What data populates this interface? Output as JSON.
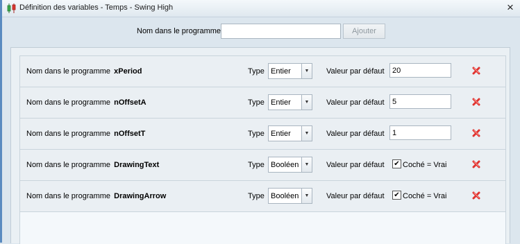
{
  "window": {
    "title": "Définition des variables - Temps - Swing High",
    "close_glyph": "×"
  },
  "top": {
    "label": "Nom dans le programme",
    "input_value": "",
    "add_button": "Ajouter"
  },
  "rows": [
    {
      "name_label": "Nom dans le programme",
      "name": "xPeriod",
      "type_label": "Type",
      "type": "Entier",
      "default_label": "Valeur par défaut",
      "default": "20"
    },
    {
      "name_label": "Nom dans le programme",
      "name": "nOffsetA",
      "type_label": "Type",
      "type": "Entier",
      "default_label": "Valeur par défaut",
      "default": "5"
    },
    {
      "name_label": "Nom dans le programme",
      "name": "nOffsetT",
      "type_label": "Type",
      "type": "Entier",
      "default_label": "Valeur par défaut",
      "default": "1"
    },
    {
      "name_label": "Nom dans le programme",
      "name": "DrawingText",
      "type_label": "Type",
      "type": "Booléen",
      "default_label": "Valeur par défaut",
      "checked": true,
      "check_label": "Coché = Vrai"
    },
    {
      "name_label": "Nom dans le programme",
      "name": "DrawingArrow",
      "type_label": "Type",
      "type": "Booléen",
      "default_label": "Valeur par défaut",
      "checked": true,
      "check_label": "Coché = Vrai"
    }
  ],
  "icons": {
    "app": "candlestick-chart-icon",
    "delete": "red-x-delete-icon",
    "dropdown": "dropdown-arrow-icon"
  },
  "colors": {
    "delete_red": "#e0332f",
    "candle_green": "#3aa84a",
    "candle_red": "#d9362f"
  }
}
